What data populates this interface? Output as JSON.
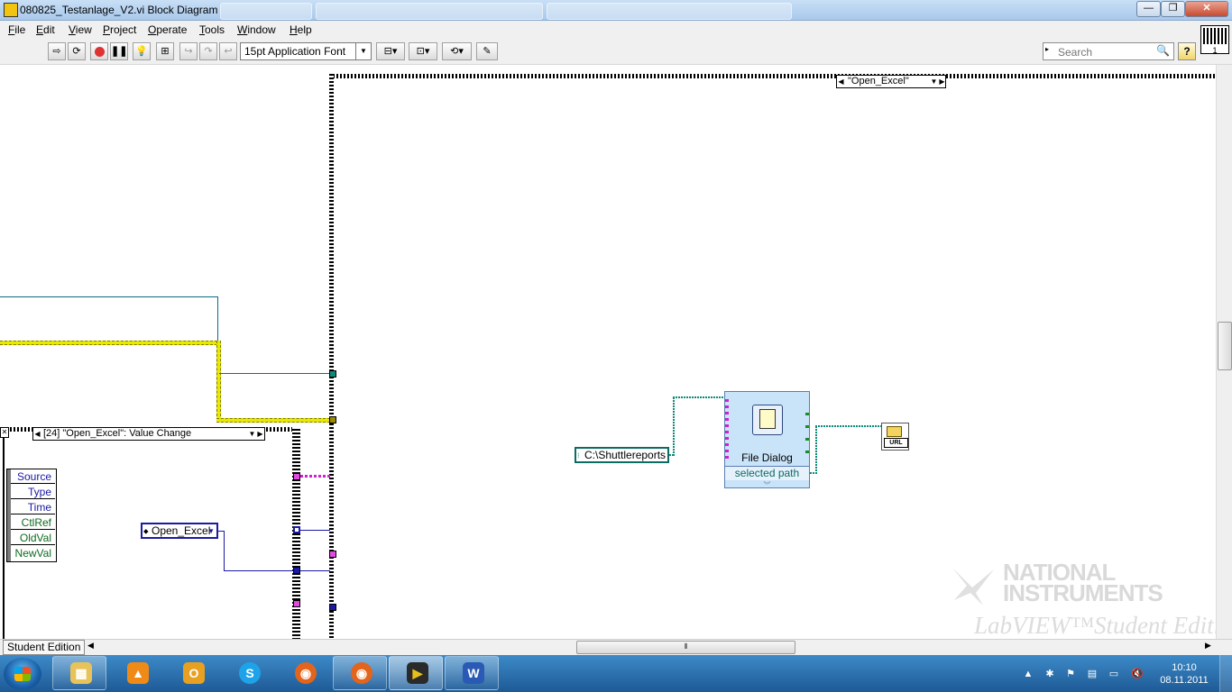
{
  "window": {
    "title": "080825_Testanlage_V2.vi Block Diagram",
    "buttons": {
      "minimize": "—",
      "maximize": "❐",
      "close": "✕"
    }
  },
  "menu": {
    "items": [
      {
        "label": "File",
        "accel": "F",
        "rest": "ile"
      },
      {
        "label": "Edit",
        "accel": "E",
        "rest": "dit"
      },
      {
        "label": "View",
        "accel": "V",
        "rest": "iew"
      },
      {
        "label": "Project",
        "accel": "P",
        "rest": "roject"
      },
      {
        "label": "Operate",
        "accel": "O",
        "rest": "perate"
      },
      {
        "label": "Tools",
        "accel": "T",
        "rest": "ools"
      },
      {
        "label": "Window",
        "accel": "W",
        "rest": "indow"
      },
      {
        "label": "Help",
        "accel": "H",
        "rest": "elp"
      }
    ]
  },
  "toolbar": {
    "font_label": "15pt Application Font",
    "search_placeholder": "Search",
    "help_label": "?",
    "vi_icon_label": "1"
  },
  "diagram": {
    "case_selector": "\"Open_Excel\"",
    "event_selector": "[24] \"Open_Excel\": Value Change",
    "event_data_rows": [
      {
        "label": "Source",
        "style": "blue"
      },
      {
        "label": "Type",
        "style": "blue"
      },
      {
        "label": "Time",
        "style": "blue"
      },
      {
        "label": "CtlRef",
        "style": "green"
      },
      {
        "label": "OldVal",
        "style": "green"
      },
      {
        "label": "NewVal",
        "style": "green"
      }
    ],
    "ring_constant": "Open_Excel",
    "path_constant": "C:\\Shuttlereports",
    "file_dialog": {
      "title": "File Dialog",
      "output": "selected path"
    },
    "url_indicator": "URL"
  },
  "watermark": {
    "brand_line1": "NATIONAL",
    "brand_line2": "INSTRUMENTS",
    "edition": "LabVIEW™Student Edition"
  },
  "statusbar": {
    "edition_tag": "Student Edition"
  },
  "taskbar": {
    "apps": [
      {
        "name": "explorer",
        "glyph": "▦",
        "color": "#e8c35a"
      },
      {
        "name": "vlc",
        "glyph": "▲",
        "color": "#f08a16"
      },
      {
        "name": "outlook",
        "glyph": "O",
        "color": "#e8a020"
      },
      {
        "name": "skype",
        "glyph": "S",
        "color": "#1fa3e8"
      },
      {
        "name": "firefox",
        "glyph": "◉",
        "color": "#e3641c"
      },
      {
        "name": "firefox-2",
        "glyph": "◉",
        "color": "#e3641c"
      },
      {
        "name": "labview",
        "glyph": "▶",
        "color": "#e8c01a"
      },
      {
        "name": "word",
        "glyph": "W",
        "color": "#2a5ab3"
      }
    ],
    "time": "10:10",
    "date": "08.11.2011"
  }
}
